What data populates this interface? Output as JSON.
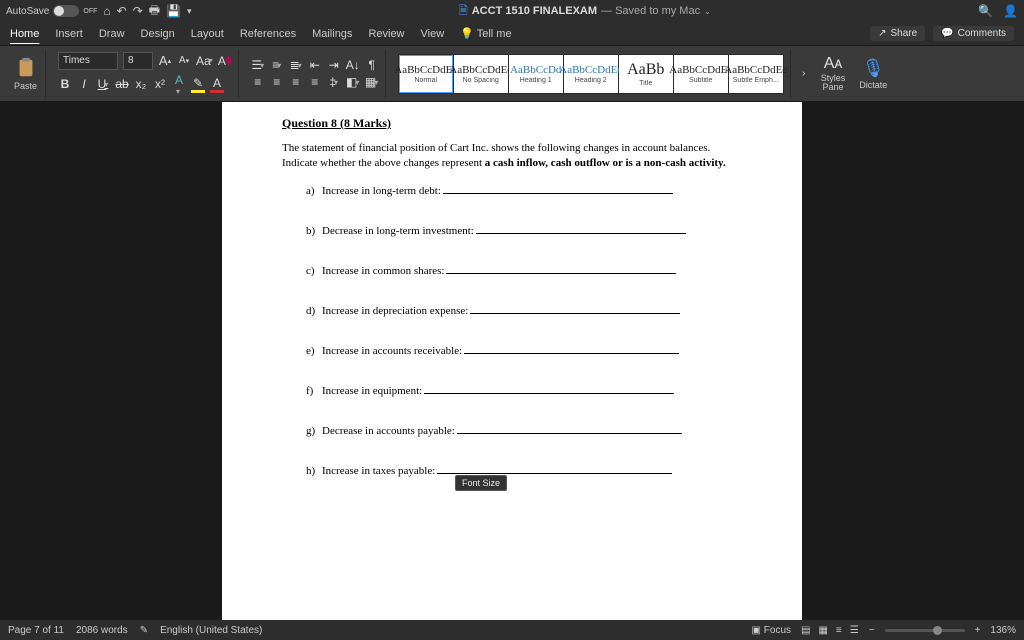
{
  "titlebar": {
    "autosave_label": "AutoSave",
    "autosave_state": "OFF",
    "doc_title": "ACCT 1510 FINALEXAM",
    "save_status": "— Saved to my Mac"
  },
  "tabs": {
    "items": [
      "Home",
      "Insert",
      "Draw",
      "Design",
      "Layout",
      "References",
      "Mailings",
      "Review",
      "View"
    ],
    "tell_me": "Tell me",
    "share": "Share",
    "comments": "Comments"
  },
  "ribbon": {
    "paste": "Paste",
    "font_name": "Times",
    "font_size": "8",
    "bold": "B",
    "italic": "I",
    "underline": "U",
    "strike": "ab",
    "sub": "x₂",
    "super": "x²",
    "increaseA": "A",
    "decreaseA": "A",
    "aa": "Aa",
    "clear": "A",
    "styles": [
      {
        "preview": "AaBbCcDdEe",
        "name": "Normal"
      },
      {
        "preview": "AaBbCcDdEe",
        "name": "No Spacing"
      },
      {
        "preview": "AaBbCcDd",
        "name": "Heading 1"
      },
      {
        "preview": "AaBbCcDdEe",
        "name": "Heading 2"
      },
      {
        "preview": "AaBb",
        "name": "Title"
      },
      {
        "preview": "AaBbCcDdEe",
        "name": "Subtitle"
      },
      {
        "preview": "AaBbCcDdEe",
        "name": "Subtle Emph..."
      }
    ],
    "styles_pane": "Styles\nPane",
    "dictate": "Dictate"
  },
  "tooltip": "Font Size",
  "document": {
    "question_label": "Question 8",
    "marks": "(8 Marks)",
    "prompt_1": "The statement of financial position of Cart Inc. shows the following changes in account balances. Indicate whether the above changes represent ",
    "prompt_bold": "a cash inflow, cash outflow or is a non-cash activity.",
    "items": [
      {
        "letter": "a)",
        "text": "Increase in long-term debt:",
        "blank": 230
      },
      {
        "letter": "b)",
        "text": "Decrease in long-term investment:",
        "blank": 210
      },
      {
        "letter": "c)",
        "text": "Increase in common shares:",
        "blank": 230
      },
      {
        "letter": "d)",
        "text": "Increase in depreciation expense:",
        "blank": 210
      },
      {
        "letter": "e)",
        "text": "Increase in accounts receivable:",
        "blank": 215
      },
      {
        "letter": "f)",
        "text": "Increase in equipment:",
        "blank": 250
      },
      {
        "letter": "g)",
        "text": "Decrease in accounts payable:",
        "blank": 225
      },
      {
        "letter": "h)",
        "text": "Increase in taxes payable:",
        "blank": 235
      }
    ]
  },
  "statusbar": {
    "page": "Page 7 of 11",
    "words": "2086 words",
    "lang": "English (United States)",
    "focus": "Focus",
    "zoom": "136%"
  }
}
